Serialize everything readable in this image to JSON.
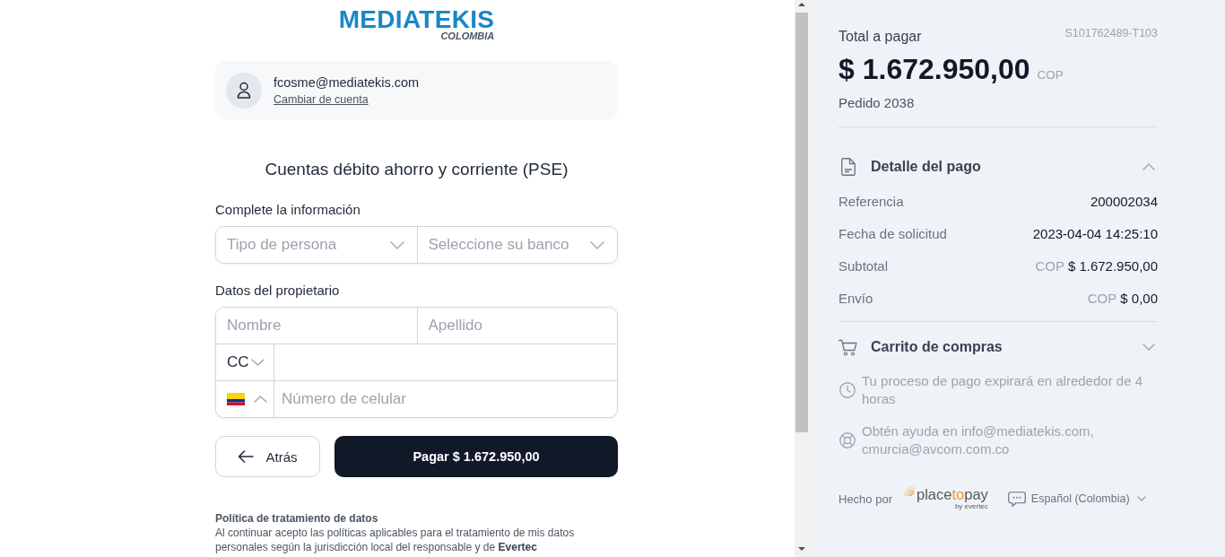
{
  "logo": {
    "wordmark": "MEDIATEKIS",
    "subtitle": "COLOMBIA"
  },
  "account": {
    "email": "fcosme@mediatekis.com",
    "link": "Cambiar de cuenta"
  },
  "title": "Cuentas débito ahorro y corriente (PSE)",
  "form_sections": [
    {
      "label": "Complete la información",
      "rows": [
        {
          "cells": [
            {
              "kind": "select",
              "placeholder": "Tipo de persona"
            },
            {
              "kind": "select",
              "placeholder": "Seleccione su banco"
            }
          ]
        }
      ]
    },
    {
      "label": "Datos del propietario",
      "rows": [
        {
          "cells": [
            {
              "kind": "input",
              "placeholder": "Nombre"
            },
            {
              "kind": "input",
              "placeholder": "Apellido"
            }
          ]
        },
        {
          "cells": [
            {
              "kind": "document_type",
              "value": "CC"
            },
            {
              "kind": "input"
            }
          ]
        },
        {
          "cells": [
            {
              "kind": "country_code"
            },
            {
              "kind": "input",
              "placeholder": "Número de celular"
            }
          ]
        }
      ]
    }
  ],
  "buttons": [
    {
      "kind": "back",
      "label": "Atrás"
    },
    {
      "kind": "pay",
      "label": "Pagar $ 1.672.950,00"
    }
  ],
  "policy": {
    "title": "Política de tratamiento de datos",
    "text": "Al continuar acepto las políticas aplicables para el tratamiento de mis datos personales según la jurisdicción local del responsable y de **Evertec**"
  },
  "summary": {
    "total_label": "Total a pagar",
    "transaction_id": "S101762489-T103",
    "amount": "$ 1.672.950,00",
    "currency": "COP",
    "order": "Pedido 2038",
    "sections": [
      {
        "kind": "detail",
        "title": "Detalle del pago",
        "expanded": true,
        "rows": [
          {
            "label": "Referencia",
            "value": "200002034"
          },
          {
            "label": "Fecha de solicitud",
            "value": "2023-04-04 14:25:10"
          },
          {
            "label": "Subtotal",
            "currency": "COP",
            "value": "$ 1.672.950,00"
          },
          {
            "label": "Envío",
            "currency": "COP",
            "value": "$ 0,00"
          }
        ]
      },
      {
        "kind": "cart",
        "title": "Carrito de compras",
        "expanded": false
      }
    ],
    "notes": [
      {
        "kind": "expiry",
        "text": "Tu proceso de pago expirará en alrededor de 4 horas"
      },
      {
        "kind": "help",
        "text": "Obtén ayuda en info@mediatekis.com, cmurcia@avcom.com.co"
      }
    ],
    "footer": {
      "made_by": "Hecho por",
      "brand": "place**to**pay",
      "brand_tagline": "by evertec",
      "language": "Español (Colombia)"
    }
  }
}
